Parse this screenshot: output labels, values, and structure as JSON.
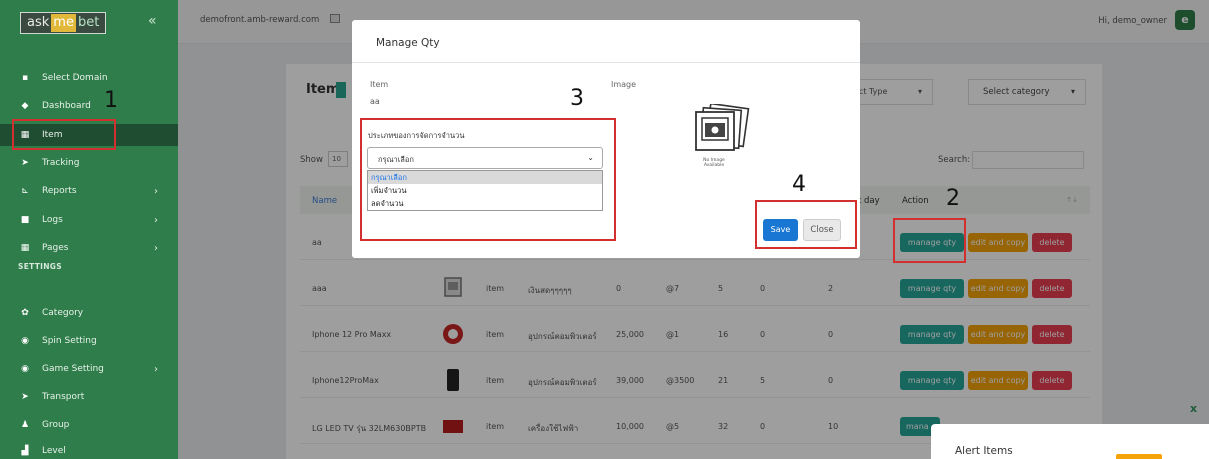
{
  "brand": {
    "word1": "ask",
    "word2": "me",
    "word3": "bet"
  },
  "sidebar": {
    "collapse_glyph": "«",
    "items": [
      {
        "label": "Select Domain",
        "icon": "domain-icon"
      },
      {
        "label": "Dashboard",
        "icon": "diamond-icon"
      },
      {
        "label": "Item",
        "icon": "table-icon"
      },
      {
        "label": "Tracking",
        "icon": "arrow-right-icon"
      },
      {
        "label": "Reports",
        "icon": "chart-icon"
      },
      {
        "label": "Logs",
        "icon": "folder-icon"
      },
      {
        "label": "Pages",
        "icon": "table-icon"
      }
    ],
    "section_label": "SETTINGS",
    "settings_items": [
      {
        "label": "Category",
        "icon": "gift-icon"
      },
      {
        "label": "Spin Setting",
        "icon": "gamepad-icon"
      },
      {
        "label": "Game Setting",
        "icon": "gamepad-icon"
      },
      {
        "label": "Transport",
        "icon": "arrow-right-icon"
      },
      {
        "label": "Group",
        "icon": "users-icon"
      },
      {
        "label": "Level",
        "icon": "bars-icon"
      }
    ]
  },
  "topbar": {
    "domain": "demofront.amb-reward.com",
    "greeting": "Hi, demo_owner",
    "avatar_letter": "e"
  },
  "page": {
    "title": "Item",
    "select_type": "ect Type",
    "select_category": "Select category",
    "show_label": "Show",
    "show_value": "10",
    "search_label": "Search:"
  },
  "table": {
    "headers": {
      "name": "Name",
      "t_day": "t day",
      "action": "Action"
    },
    "rows": [
      {
        "name": "aa",
        "type": "",
        "category": "",
        "price": "",
        "code": "",
        "qty": "",
        "used": "",
        "tday": ""
      },
      {
        "name": "aaa",
        "type": "item",
        "category": "เงินสดๆๆๆๆๆ",
        "price": "0",
        "code": "@7",
        "qty": "5",
        "used": "0",
        "tday": "2"
      },
      {
        "name": "Iphone 12 Pro Maxx",
        "type": "item",
        "category": "อุปกรณ์คอมพิวเตอร์",
        "price": "25,000",
        "code": "@1",
        "qty": "16",
        "used": "0",
        "tday": "0"
      },
      {
        "name": "Iphone12ProMax",
        "type": "item",
        "category": "อุปกรณ์คอมพิวเตอร์",
        "price": "39,000",
        "code": "@3500",
        "qty": "21",
        "used": "5",
        "tday": "0"
      },
      {
        "name": "LG LED TV รุ่น 32LM630BPTB",
        "type": "item",
        "category": "เครื่องใช้ไฟฟ้า",
        "price": "10,000",
        "code": "@5",
        "qty": "32",
        "used": "0",
        "tday": "10"
      }
    ],
    "buttons": {
      "qty": "manage qty",
      "edit": "edit and copy",
      "delete": "delete",
      "qty_partial": "mana"
    }
  },
  "modal": {
    "title": "Manage Qty",
    "item_label": "Item",
    "item_value": "aa",
    "image_label": "Image",
    "no_image_text": "No Image Available",
    "qty_type_label": "ประเภทของการจัดการจำนวน",
    "select_value": "กรุณาเลือก",
    "options": [
      "กรุณาเลือก",
      "เพิ่มจำนวน",
      "ลดจำนวน"
    ],
    "save_label": "Save",
    "close_label": "Close"
  },
  "annotations": [
    "1",
    "2",
    "3",
    "4"
  ],
  "alert": {
    "close_glyph": "x",
    "title": "Alert Items"
  },
  "colors": {
    "sidebar": "#2e7d4a",
    "accent_teal": "#26a69a",
    "accent_orange": "#f4a30a",
    "accent_red": "#e83e4f",
    "save_blue": "#1976d2",
    "annotation_red": "#d32f2f"
  }
}
